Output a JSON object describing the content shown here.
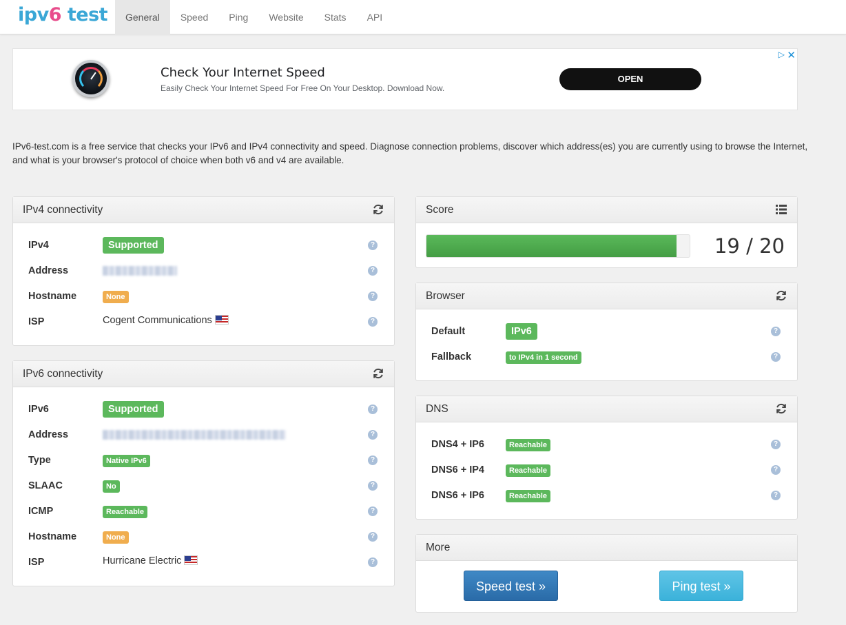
{
  "logo": {
    "part1": "ipv",
    "part2": "6",
    "part3": " test"
  },
  "nav": [
    {
      "label": "General",
      "active": true
    },
    {
      "label": "Speed",
      "active": false
    },
    {
      "label": "Ping",
      "active": false
    },
    {
      "label": "Website",
      "active": false
    },
    {
      "label": "Stats",
      "active": false
    },
    {
      "label": "API",
      "active": false
    }
  ],
  "ad": {
    "title": "Check Your Internet Speed",
    "subtitle": "Easily Check Your Internet Speed For Free On Your Desktop. Download Now.",
    "button": "OPEN",
    "choices_icon": "▷",
    "close_icon": "✕"
  },
  "intro": "IPv6-test.com is a free service that checks your IPv6 and IPv4 connectivity and speed. Diagnose connection problems, discover which address(es) you are currently using to browse the Internet, and what is your browser's protocol of choice when both v6 and v4 are available.",
  "help_glyph": "?",
  "ipv4": {
    "title": "IPv4 connectivity",
    "rows": {
      "ipv4": {
        "label": "IPv4",
        "value": "Supported"
      },
      "address": {
        "label": "Address"
      },
      "hostname": {
        "label": "Hostname",
        "value": "None"
      },
      "isp": {
        "label": "ISP",
        "value": "Cogent Communications"
      }
    }
  },
  "ipv6": {
    "title": "IPv6 connectivity",
    "rows": {
      "ipv6": {
        "label": "IPv6",
        "value": "Supported"
      },
      "address": {
        "label": "Address"
      },
      "type": {
        "label": "Type",
        "value": "Native IPv6"
      },
      "slaac": {
        "label": "SLAAC",
        "value": "No"
      },
      "icmp": {
        "label": "ICMP",
        "value": "Reachable"
      },
      "hostname": {
        "label": "Hostname",
        "value": "None"
      },
      "isp": {
        "label": "ISP",
        "value": "Hurricane Electric"
      }
    }
  },
  "score": {
    "title": "Score",
    "text": "19 / 20",
    "value": 19,
    "max": 20
  },
  "browser": {
    "title": "Browser",
    "default": {
      "label": "Default",
      "value": "IPv6"
    },
    "fallback": {
      "label": "Fallback",
      "value": "to IPv4 in 1 second"
    }
  },
  "dns": {
    "title": "DNS",
    "rows": [
      {
        "label": "DNS4 + IP6",
        "value": "Reachable"
      },
      {
        "label": "DNS6 + IP4",
        "value": "Reachable"
      },
      {
        "label": "DNS6 + IP6",
        "value": "Reachable"
      }
    ]
  },
  "more": {
    "title": "More",
    "speed_button": "Speed test »",
    "ping_button": "Ping test »"
  },
  "colors": {
    "success": "#5cb85c",
    "warning": "#f0ad4e",
    "primary": "#337ab7",
    "info": "#5bc0de"
  }
}
